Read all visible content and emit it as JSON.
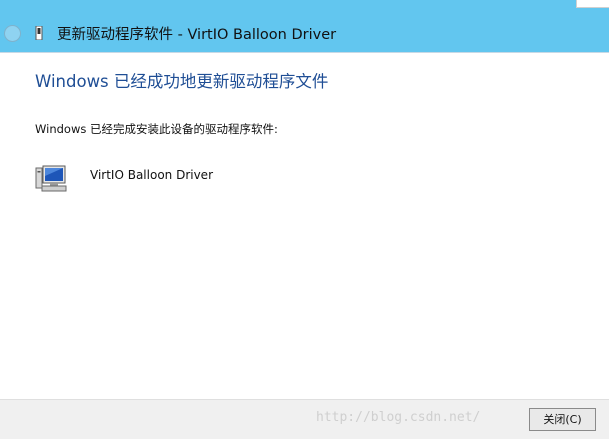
{
  "window": {
    "title": "更新驱动程序软件 - VirtIO Balloon Driver"
  },
  "content": {
    "heading": "Windows 已经成功地更新驱动程序文件",
    "description": "Windows 已经完成安装此设备的驱动程序软件:",
    "device_name": "VirtIO Balloon Driver"
  },
  "footer": {
    "watermark": "http://blog.csdn.net/",
    "close_button_label": "关闭(C)"
  },
  "colors": {
    "titlebar": "#62c6ef",
    "heading": "#1f4e95",
    "footer": "#f0f0f0"
  },
  "icons": {
    "back": "back-arrow-icon",
    "title_device": "device-icon",
    "device": "computer-device-icon"
  }
}
